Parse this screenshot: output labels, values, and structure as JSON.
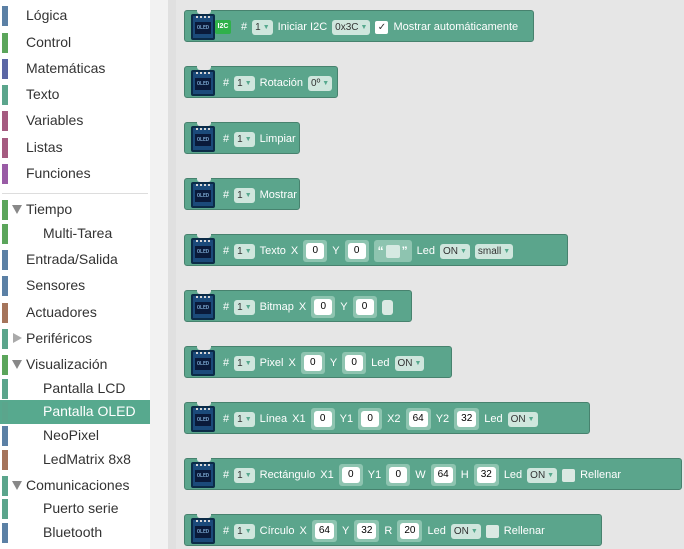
{
  "toolbox": {
    "categories": [
      {
        "label": "Lógica",
        "color": "#5b80a5"
      },
      {
        "label": "Control",
        "color": "#5ba55b"
      },
      {
        "label": "Matemáticas",
        "color": "#5b67a5"
      },
      {
        "label": "Texto",
        "color": "#5ba58c"
      },
      {
        "label": "Variables",
        "color": "#a55b80"
      },
      {
        "label": "Listas",
        "color": "#745ba5"
      },
      {
        "label": "Funciones",
        "color": "#995ba5"
      },
      {
        "label": "Tiempo",
        "color": "#5ba55b"
      },
      {
        "label": "Multi-Tarea",
        "color": "#5ba55b"
      },
      {
        "label": "Entrada/Salida",
        "color": "#5b80a5"
      },
      {
        "label": "Sensores",
        "color": "#5b80a5"
      },
      {
        "label": "Actuadores",
        "color": "#a5745b"
      },
      {
        "label": "Periféricos",
        "color": "#5ba58c"
      },
      {
        "label": "Visualización",
        "color": "#5ba55b"
      },
      {
        "label": "Pantalla LCD",
        "color": "#5ba58c"
      },
      {
        "label": "Pantalla OLED",
        "color": "#5ba58c"
      },
      {
        "label": "NeoPixel",
        "color": "#5b80a5"
      },
      {
        "label": "LedMatrix 8x8",
        "color": "#a5745b"
      },
      {
        "label": "Comunicaciones",
        "color": "#5ba58c"
      },
      {
        "label": "Puerto serie",
        "color": "#5ba58c"
      },
      {
        "label": "Bluetooth",
        "color": "#5b80a5"
      }
    ]
  },
  "blocks": {
    "hash": "#",
    "one": "1",
    "oled_screen": "OLED",
    "i2c_badge": "I2C",
    "init": {
      "label": "Iniciar I2C",
      "address": "0x3C",
      "check": "✓",
      "auto": "Mostrar automáticamente"
    },
    "rotation": {
      "label": "Rotación",
      "value": "0º"
    },
    "clear": {
      "label": "Limpiar"
    },
    "show": {
      "label": "Mostrar"
    },
    "text": {
      "label": "Texto",
      "x_label": "X",
      "x": "0",
      "y_label": "Y",
      "y": "0",
      "quote_open": "“",
      "quote_close": "”",
      "led_label": "Led",
      "led": "ON",
      "size": "small"
    },
    "bitmap": {
      "label": "Bitmap",
      "x_label": "X",
      "x": "0",
      "y_label": "Y",
      "y": "0"
    },
    "pixel": {
      "label": "Pixel",
      "x_label": "X",
      "x": "0",
      "y_label": "Y",
      "y": "0",
      "led_label": "Led",
      "led": "ON"
    },
    "line": {
      "label": "Línea",
      "x1_label": "X1",
      "x1": "0",
      "y1_label": "Y1",
      "y1": "0",
      "x2_label": "X2",
      "x2": "64",
      "y2_label": "Y2",
      "y2": "32",
      "led_label": "Led",
      "led": "ON"
    },
    "rect": {
      "label": "Rectángulo",
      "x1_label": "X1",
      "x1": "0",
      "y1_label": "Y1",
      "y1": "0",
      "w_label": "W",
      "w": "64",
      "h_label": "H",
      "h": "32",
      "led_label": "Led",
      "led": "ON",
      "fill": "Rellenar"
    },
    "circle": {
      "label": "Círculo",
      "x_label": "X",
      "x": "64",
      "y_label": "Y",
      "y": "32",
      "r_label": "R",
      "r": "20",
      "led_label": "Led",
      "led": "ON",
      "fill": "Rellenar"
    }
  },
  "icons": {
    "dropdown": "▼"
  }
}
